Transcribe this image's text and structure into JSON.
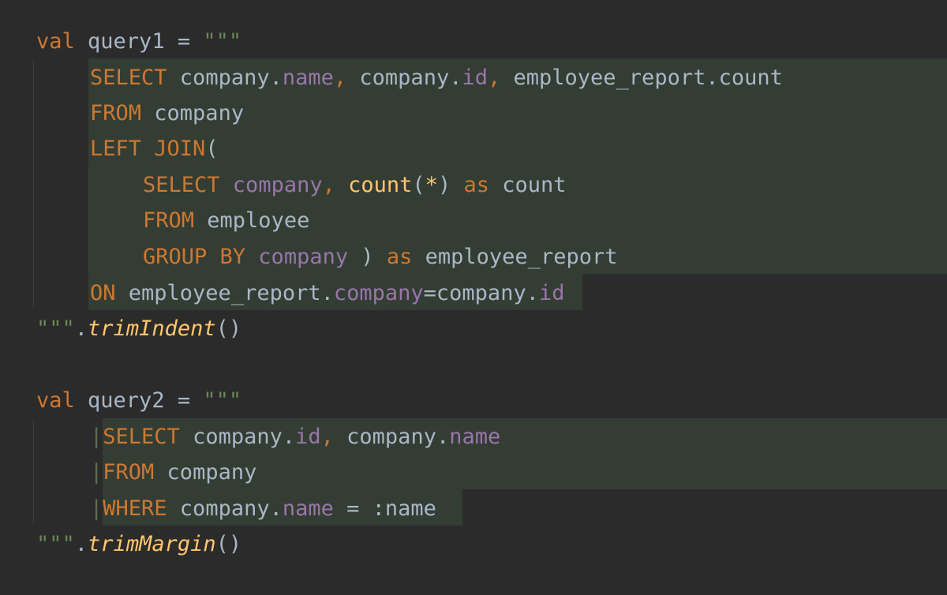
{
  "query1": {
    "header": {
      "kw": "val",
      "name": " query1 = ",
      "quotes": "\"\"\""
    },
    "lines": [
      {
        "kw": "SELECT",
        "rest": [
          [
            "plain",
            " company."
          ],
          [
            "prop",
            "name"
          ],
          [
            "kw",
            ","
          ],
          [
            "plain",
            " company."
          ],
          [
            "prop",
            "id"
          ],
          [
            "kw",
            ","
          ],
          [
            "plain",
            " employee_report.count"
          ]
        ]
      },
      {
        "kw": "FROM",
        "rest": [
          [
            "plain",
            " company"
          ]
        ]
      },
      {
        "kw": "LEFT JOIN",
        "rest": [
          [
            "plain",
            "("
          ]
        ]
      },
      {
        "kw": "SELECT",
        "rest": [
          [
            "prop",
            " company"
          ],
          [
            "kw",
            ","
          ],
          [
            "fn",
            " count"
          ],
          [
            "plain",
            "("
          ],
          [
            "fn",
            "*"
          ],
          [
            "plain",
            ")"
          ],
          [
            "kw",
            " as"
          ],
          [
            "plain",
            " count"
          ]
        ]
      },
      {
        "kw": "FROM",
        "rest": [
          [
            "plain",
            " employee"
          ]
        ]
      },
      {
        "kw": "GROUP BY",
        "rest": [
          [
            "prop",
            " company"
          ],
          [
            "plain",
            " ) "
          ],
          [
            "kw",
            "as"
          ],
          [
            "plain",
            " employee_report"
          ]
        ]
      },
      {
        "kw": "ON",
        "rest": [
          [
            "plain",
            " employee_report."
          ],
          [
            "prop",
            "company"
          ],
          [
            "plain",
            "=company."
          ],
          [
            "prop",
            "id"
          ]
        ]
      }
    ],
    "footer": {
      "quotes": "\"\"\"",
      "dot": ".",
      "call": "trimIndent",
      "parens": "()"
    }
  },
  "query2": {
    "header": {
      "kw": "val",
      "name": " query2 = ",
      "quotes": "\"\"\""
    },
    "margin_char": "|",
    "lines": [
      {
        "kw": "SELECT",
        "rest": [
          [
            "plain",
            " company."
          ],
          [
            "prop",
            "id"
          ],
          [
            "kw",
            ","
          ],
          [
            "plain",
            " company."
          ],
          [
            "prop",
            "name"
          ]
        ]
      },
      {
        "kw": "FROM",
        "rest": [
          [
            "plain",
            " company"
          ]
        ]
      },
      {
        "kw": "WHERE",
        "rest": [
          [
            "plain",
            " company."
          ],
          [
            "prop",
            "name"
          ],
          [
            "plain",
            " = :name "
          ]
        ]
      }
    ],
    "footer": {
      "quotes": "\"\"\"",
      "dot": ".",
      "call": "trimMargin",
      "parens": "()"
    }
  },
  "colors": {
    "background": "#2b2b2b",
    "keyword": "#cc7832",
    "property": "#9876aa",
    "string": "#6a8759",
    "text": "#a9b7c6",
    "function": "#ffc66d",
    "injection_highlight": "#343d33"
  }
}
